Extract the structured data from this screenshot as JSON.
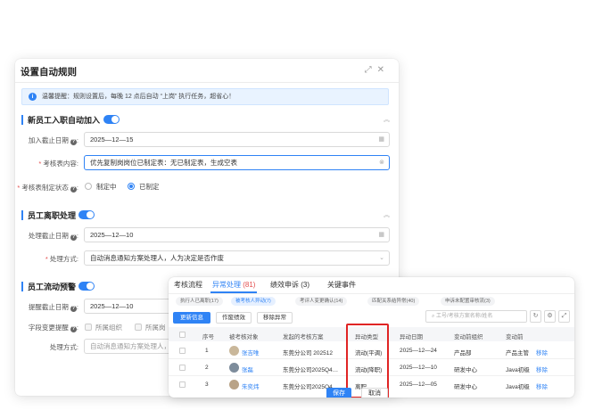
{
  "dialog": {
    "title": "设置自动规则",
    "notice": "温馨提醒：规则设置后，每晚 12 点后自动 “上岗” 执行任务，超省心！",
    "sections": [
      {
        "title": "新员工入职自动加入",
        "enabled": true,
        "fields": [
          {
            "label": "加入截止日期",
            "value": "2025—12—15"
          },
          {
            "label": "考核表内容",
            "value": "优先复制岗岗位已制定表：无已制定表，生成空表"
          }
        ],
        "status_label": "考核表制定状态",
        "status_options": [
          "制定中",
          "已制定"
        ],
        "status_selected": "已制定"
      },
      {
        "title": "员工离职处理",
        "enabled": true,
        "fields": [
          {
            "label": "处理截止日期",
            "value": "2025—12—10"
          },
          {
            "label": "处理方式",
            "value": "自动消息通知方案处理人，人为决定是否作废"
          }
        ]
      },
      {
        "title": "员工流动预警",
        "enabled": true,
        "fields": [
          {
            "label": "提醒截止日期",
            "value": "2025—12—10"
          },
          {
            "label": "处理方式",
            "value": "自动消息通知方案处理人，"
          }
        ],
        "change_label": "字段变更提醒",
        "change_options": [
          "所属组织",
          "所属岗"
        ]
      }
    ],
    "footer": {
      "save": "保存",
      "cancel": "取消"
    }
  },
  "panel": {
    "tabs": [
      {
        "label": "考核流程",
        "count": ""
      },
      {
        "label": "异常处理",
        "count": "(81)"
      },
      {
        "label": "绩效申诉",
        "count": "(3)"
      },
      {
        "label": "关键事件",
        "count": ""
      }
    ],
    "chips": [
      "执行人已离职(17)",
      "被考核人异动(7)",
      "考评人变更确认(14)",
      "匹配关系结异常(40)",
      "申诉未配置审核流(3)"
    ],
    "buttons": [
      "更新信息",
      "作废绩效",
      "移除异常"
    ],
    "search_placeholder": "工号/考核方案名称/姓名",
    "columns": [
      "序号",
      "被考核对象",
      "发起的考核方案",
      "异动类型",
      "异动日期",
      "变动前组织",
      "变动前"
    ],
    "rows": [
      {
        "no": "1",
        "name": "张吉唯",
        "plan": "东莞分公司 202512",
        "type": "流动(平调)",
        "date": "2025—12—24",
        "org": "产品部",
        "pos": "产品主管",
        "op": "移除"
      },
      {
        "no": "2",
        "name": "张磊",
        "plan": "东莞分公司2025Q4…",
        "type": "流动(降职)",
        "date": "2025—12—10",
        "org": "研发中心",
        "pos": "Java初级",
        "op": "移除"
      },
      {
        "no": "3",
        "name": "朱奕炜",
        "plan": "东莞分公司2025Q4…",
        "type": "离职",
        "date": "2025—12—05",
        "org": "研发中心",
        "pos": "Java初级",
        "op": "移除"
      }
    ]
  },
  "colors": {
    "accent": "#2f83f5",
    "highlight": "#e02424",
    "required": "#e34d4d"
  }
}
